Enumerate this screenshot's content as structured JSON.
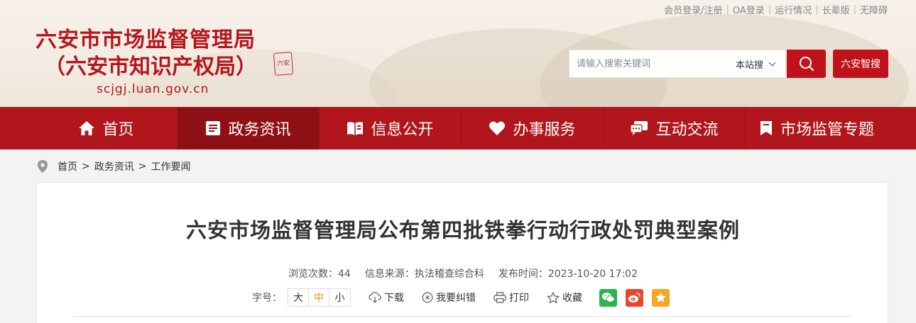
{
  "top_links": [
    "会员登录/注册",
    "OA登录",
    "运行情况",
    "长辈版",
    "无障碍"
  ],
  "site": {
    "name_line1": "六安市市场监督管理局",
    "name_line2": "（六安市知识产权局）",
    "domain": "scjgj.luan.gov.cn",
    "seal_text": "六安"
  },
  "search": {
    "placeholder": "请输入搜索关键词",
    "scope": "本站搜",
    "zhisou_label": "六安智搜"
  },
  "nav": [
    {
      "label": "首页",
      "icon": "home-icon"
    },
    {
      "label": "政务资讯",
      "icon": "news-icon",
      "active": true
    },
    {
      "label": "信息公开",
      "icon": "book-icon"
    },
    {
      "label": "办事服务",
      "icon": "heart-icon"
    },
    {
      "label": "互动交流",
      "icon": "chat-icon"
    },
    {
      "label": "市场监管专题",
      "icon": "bookmark-icon"
    }
  ],
  "breadcrumb": [
    "首页",
    "政务资讯",
    "工作要闻"
  ],
  "article": {
    "title": "六安市场监督管理局公布第四批铁拳行动行政处罚典型案例",
    "views": "浏览次数：44",
    "source": "信息来源：执法稽查综合科",
    "published": "发布时间：2023-10-20 17:02",
    "font_size_label": "字号：",
    "font_sizes": [
      "大",
      "中",
      "小"
    ],
    "download": "下载",
    "report_error": "我要纠错",
    "print": "打印",
    "favorite": "收藏"
  },
  "colors": {
    "brand_red": "#b0161c",
    "nav_active": "#8e1015",
    "accent_orange": "#e08a00",
    "wechat_green": "#2fb44b",
    "weibo_red": "#e8462e",
    "qzone_orange": "#f5a623"
  }
}
